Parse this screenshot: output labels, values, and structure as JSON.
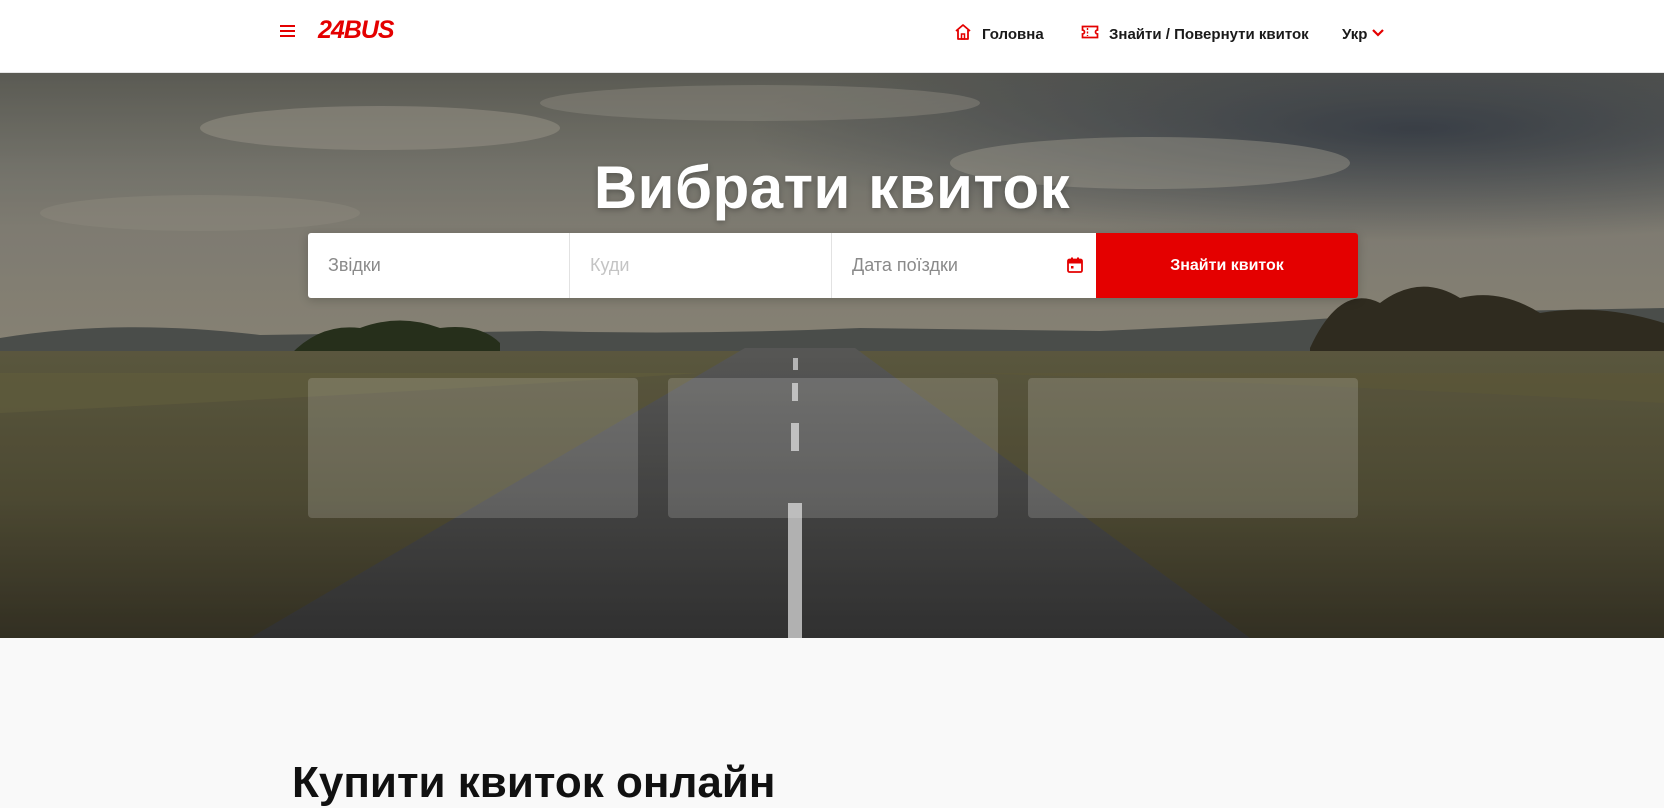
{
  "header": {
    "logo": "24BUS",
    "nav": {
      "home_label": "Головна",
      "ticket_label": "Знайти / Повернути квиток"
    },
    "language": "Укр"
  },
  "hero": {
    "title": "Вибрати квиток",
    "search": {
      "from_placeholder": "Звідки",
      "to_placeholder": "Куди",
      "date_placeholder": "Дата поїздки",
      "button_label": "Знайти квиток"
    }
  },
  "section": {
    "title": "Купити квиток онлайн"
  },
  "colors": {
    "accent": "#e40000",
    "header_bg": "#ffffff",
    "page_bg": "#f9f9f9"
  },
  "icons": [
    "menu-icon",
    "home-icon",
    "ticket-icon",
    "chevron-down-icon",
    "calendar-icon"
  ]
}
